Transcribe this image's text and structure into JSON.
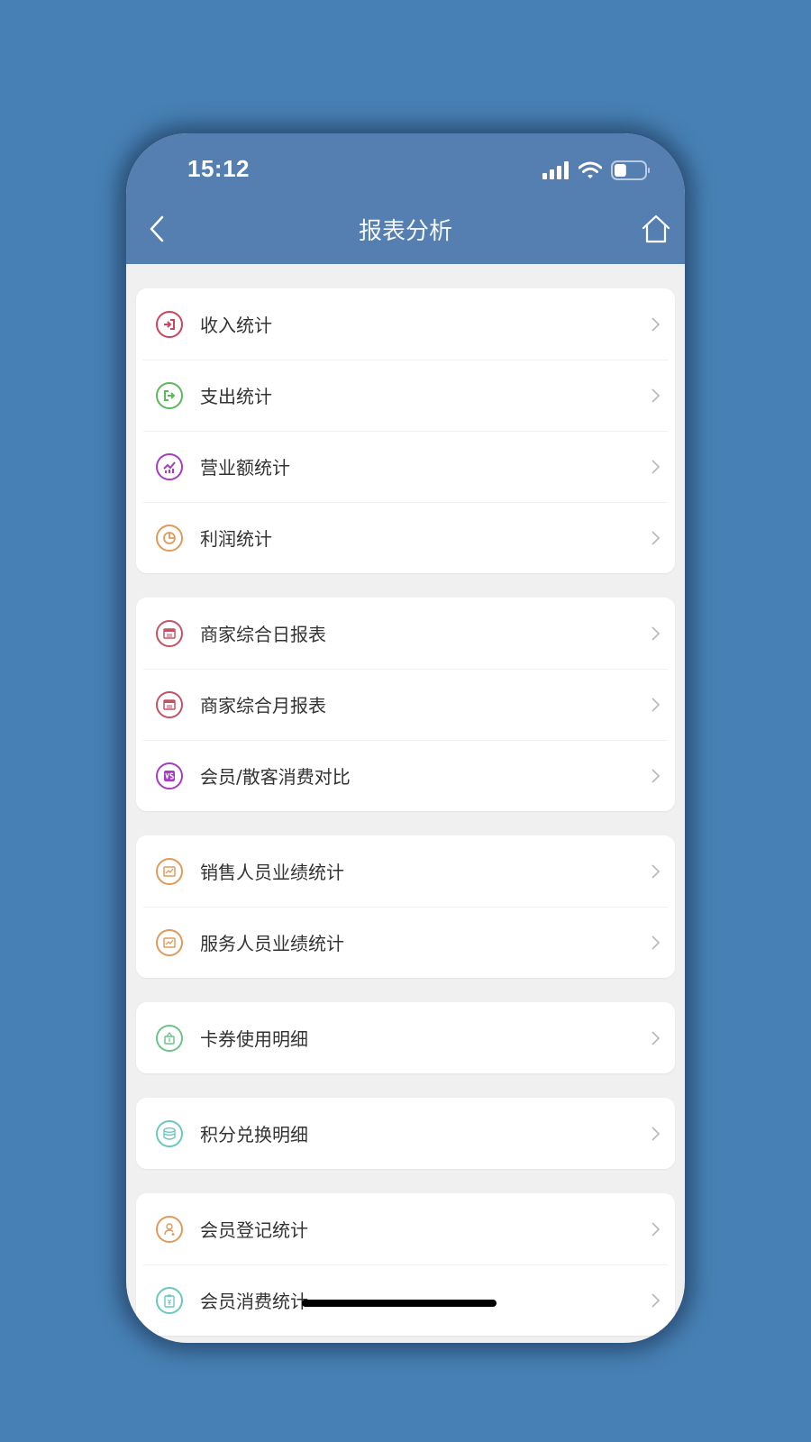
{
  "status_bar": {
    "time": "15:12",
    "icons": [
      "signal-icon",
      "wifi-icon",
      "battery-icon"
    ],
    "battery_level": 0.4
  },
  "nav": {
    "title": "报表分析",
    "back_icon": "chevron-left-icon",
    "home_icon": "home-icon"
  },
  "colors": {
    "header_bg": "#557fb1",
    "page_bg": "#4780b4",
    "content_bg": "#f0f0f0"
  },
  "groups": [
    {
      "items": [
        {
          "label": "收入统计",
          "icon": "income-icon",
          "color": "#c9455f"
        },
        {
          "label": "支出统计",
          "icon": "expense-icon",
          "color": "#5cb85c"
        },
        {
          "label": "营业额统计",
          "icon": "turnover-chart-icon",
          "color": "#a63bc4"
        },
        {
          "label": "利润统计",
          "icon": "profit-pie-icon",
          "color": "#e09a5a"
        }
      ]
    },
    {
      "items": [
        {
          "label": "商家综合日报表",
          "icon": "daily-report-icon",
          "color": "#c45265"
        },
        {
          "label": "商家综合月报表",
          "icon": "monthly-report-icon",
          "color": "#c45265"
        },
        {
          "label": "会员/散客消费对比",
          "icon": "vs-compare-icon",
          "color": "#a63bc4"
        }
      ]
    },
    {
      "items": [
        {
          "label": "销售人员业绩统计",
          "icon": "sales-performance-icon",
          "color": "#e09a5a"
        },
        {
          "label": "服务人员业绩统计",
          "icon": "service-performance-icon",
          "color": "#e09a5a"
        }
      ]
    },
    {
      "items": [
        {
          "label": "卡券使用明细",
          "icon": "coupon-bag-icon",
          "color": "#6cc48a"
        }
      ]
    },
    {
      "items": [
        {
          "label": "积分兑换明细",
          "icon": "points-stack-icon",
          "color": "#6cc7bc"
        }
      ]
    },
    {
      "items": [
        {
          "label": "会员登记统计",
          "icon": "member-register-icon",
          "color": "#e09a5a"
        },
        {
          "label": "会员消费统计",
          "icon": "member-consume-icon",
          "color": "#6cc7bc"
        }
      ]
    }
  ]
}
